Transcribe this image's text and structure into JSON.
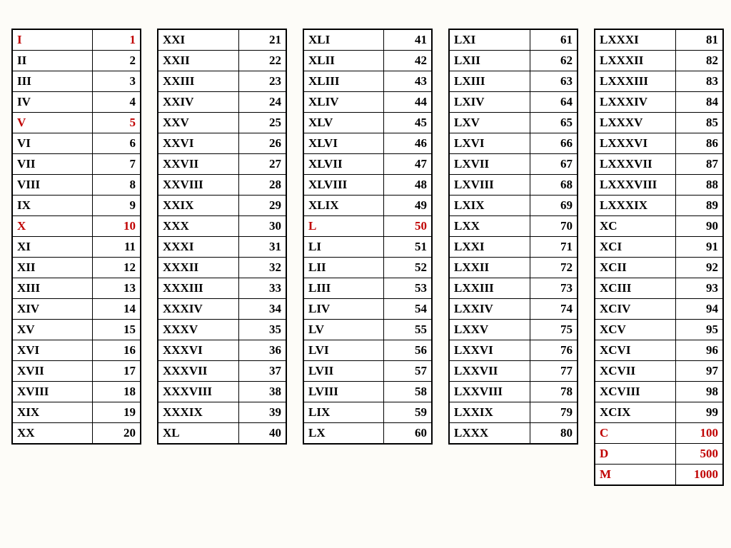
{
  "highlight_color": "#c00000",
  "columns": [
    [
      {
        "roman": "I",
        "arabic": 1,
        "highlight": true
      },
      {
        "roman": "II",
        "arabic": 2,
        "highlight": false
      },
      {
        "roman": "III",
        "arabic": 3,
        "highlight": false
      },
      {
        "roman": "IV",
        "arabic": 4,
        "highlight": false
      },
      {
        "roman": "V",
        "arabic": 5,
        "highlight": true
      },
      {
        "roman": "VI",
        "arabic": 6,
        "highlight": false
      },
      {
        "roman": "VII",
        "arabic": 7,
        "highlight": false
      },
      {
        "roman": "VIII",
        "arabic": 8,
        "highlight": false
      },
      {
        "roman": "IX",
        "arabic": 9,
        "highlight": false
      },
      {
        "roman": "X",
        "arabic": 10,
        "highlight": true
      },
      {
        "roman": "XI",
        "arabic": 11,
        "highlight": false
      },
      {
        "roman": "XII",
        "arabic": 12,
        "highlight": false
      },
      {
        "roman": "XIII",
        "arabic": 13,
        "highlight": false
      },
      {
        "roman": "XIV",
        "arabic": 14,
        "highlight": false
      },
      {
        "roman": "XV",
        "arabic": 15,
        "highlight": false
      },
      {
        "roman": "XVI",
        "arabic": 16,
        "highlight": false
      },
      {
        "roman": "XVII",
        "arabic": 17,
        "highlight": false
      },
      {
        "roman": "XVIII",
        "arabic": 18,
        "highlight": false
      },
      {
        "roman": "XIX",
        "arabic": 19,
        "highlight": false
      },
      {
        "roman": "XX",
        "arabic": 20,
        "highlight": false
      }
    ],
    [
      {
        "roman": "XXI",
        "arabic": 21,
        "highlight": false
      },
      {
        "roman": "XXII",
        "arabic": 22,
        "highlight": false
      },
      {
        "roman": "XXIII",
        "arabic": 23,
        "highlight": false
      },
      {
        "roman": "XXIV",
        "arabic": 24,
        "highlight": false
      },
      {
        "roman": "XXV",
        "arabic": 25,
        "highlight": false
      },
      {
        "roman": "XXVI",
        "arabic": 26,
        "highlight": false
      },
      {
        "roman": "XXVII",
        "arabic": 27,
        "highlight": false
      },
      {
        "roman": "XXVIII",
        "arabic": 28,
        "highlight": false
      },
      {
        "roman": "XXIX",
        "arabic": 29,
        "highlight": false
      },
      {
        "roman": "XXX",
        "arabic": 30,
        "highlight": false
      },
      {
        "roman": "XXXI",
        "arabic": 31,
        "highlight": false
      },
      {
        "roman": "XXXII",
        "arabic": 32,
        "highlight": false
      },
      {
        "roman": "XXXIII",
        "arabic": 33,
        "highlight": false
      },
      {
        "roman": "XXXIV",
        "arabic": 34,
        "highlight": false
      },
      {
        "roman": "XXXV",
        "arabic": 35,
        "highlight": false
      },
      {
        "roman": "XXXVI",
        "arabic": 36,
        "highlight": false
      },
      {
        "roman": "XXXVII",
        "arabic": 37,
        "highlight": false
      },
      {
        "roman": "XXXVIII",
        "arabic": 38,
        "highlight": false
      },
      {
        "roman": "XXXIX",
        "arabic": 39,
        "highlight": false
      },
      {
        "roman": "XL",
        "arabic": 40,
        "highlight": false
      }
    ],
    [
      {
        "roman": "XLI",
        "arabic": 41,
        "highlight": false
      },
      {
        "roman": "XLII",
        "arabic": 42,
        "highlight": false
      },
      {
        "roman": "XLIII",
        "arabic": 43,
        "highlight": false
      },
      {
        "roman": "XLIV",
        "arabic": 44,
        "highlight": false
      },
      {
        "roman": "XLV",
        "arabic": 45,
        "highlight": false
      },
      {
        "roman": "XLVI",
        "arabic": 46,
        "highlight": false
      },
      {
        "roman": "XLVII",
        "arabic": 47,
        "highlight": false
      },
      {
        "roman": "XLVIII",
        "arabic": 48,
        "highlight": false
      },
      {
        "roman": "XLIX",
        "arabic": 49,
        "highlight": false
      },
      {
        "roman": "L",
        "arabic": 50,
        "highlight": true
      },
      {
        "roman": "LI",
        "arabic": 51,
        "highlight": false
      },
      {
        "roman": "LII",
        "arabic": 52,
        "highlight": false
      },
      {
        "roman": "LIII",
        "arabic": 53,
        "highlight": false
      },
      {
        "roman": "LIV",
        "arabic": 54,
        "highlight": false
      },
      {
        "roman": "LV",
        "arabic": 55,
        "highlight": false
      },
      {
        "roman": "LVI",
        "arabic": 56,
        "highlight": false
      },
      {
        "roman": "LVII",
        "arabic": 57,
        "highlight": false
      },
      {
        "roman": "LVIII",
        "arabic": 58,
        "highlight": false
      },
      {
        "roman": "LIX",
        "arabic": 59,
        "highlight": false
      },
      {
        "roman": "LX",
        "arabic": 60,
        "highlight": false
      }
    ],
    [
      {
        "roman": "LXI",
        "arabic": 61,
        "highlight": false
      },
      {
        "roman": "LXII",
        "arabic": 62,
        "highlight": false
      },
      {
        "roman": "LXIII",
        "arabic": 63,
        "highlight": false
      },
      {
        "roman": "LXIV",
        "arabic": 64,
        "highlight": false
      },
      {
        "roman": "LXV",
        "arabic": 65,
        "highlight": false
      },
      {
        "roman": "LXVI",
        "arabic": 66,
        "highlight": false
      },
      {
        "roman": "LXVII",
        "arabic": 67,
        "highlight": false
      },
      {
        "roman": "LXVIII",
        "arabic": 68,
        "highlight": false
      },
      {
        "roman": "LXIX",
        "arabic": 69,
        "highlight": false
      },
      {
        "roman": "LXX",
        "arabic": 70,
        "highlight": false
      },
      {
        "roman": "LXXI",
        "arabic": 71,
        "highlight": false
      },
      {
        "roman": "LXXII",
        "arabic": 72,
        "highlight": false
      },
      {
        "roman": "LXXIII",
        "arabic": 73,
        "highlight": false
      },
      {
        "roman": "LXXIV",
        "arabic": 74,
        "highlight": false
      },
      {
        "roman": "LXXV",
        "arabic": 75,
        "highlight": false
      },
      {
        "roman": "LXXVI",
        "arabic": 76,
        "highlight": false
      },
      {
        "roman": "LXXVII",
        "arabic": 77,
        "highlight": false
      },
      {
        "roman": "LXXVIII",
        "arabic": 78,
        "highlight": false
      },
      {
        "roman": "LXXIX",
        "arabic": 79,
        "highlight": false
      },
      {
        "roman": "LXXX",
        "arabic": 80,
        "highlight": false
      }
    ],
    [
      {
        "roman": "LXXXI",
        "arabic": 81,
        "highlight": false
      },
      {
        "roman": "LXXXII",
        "arabic": 82,
        "highlight": false
      },
      {
        "roman": "LXXXIII",
        "arabic": 83,
        "highlight": false
      },
      {
        "roman": "LXXXIV",
        "arabic": 84,
        "highlight": false
      },
      {
        "roman": "LXXXV",
        "arabic": 85,
        "highlight": false
      },
      {
        "roman": "LXXXVI",
        "arabic": 86,
        "highlight": false
      },
      {
        "roman": "LXXXVII",
        "arabic": 87,
        "highlight": false
      },
      {
        "roman": "LXXXVIII",
        "arabic": 88,
        "highlight": false
      },
      {
        "roman": "LXXXIX",
        "arabic": 89,
        "highlight": false
      },
      {
        "roman": "XC",
        "arabic": 90,
        "highlight": false
      },
      {
        "roman": "XCI",
        "arabic": 91,
        "highlight": false
      },
      {
        "roman": "XCII",
        "arabic": 92,
        "highlight": false
      },
      {
        "roman": "XCIII",
        "arabic": 93,
        "highlight": false
      },
      {
        "roman": "XCIV",
        "arabic": 94,
        "highlight": false
      },
      {
        "roman": "XCV",
        "arabic": 95,
        "highlight": false
      },
      {
        "roman": "XCVI",
        "arabic": 96,
        "highlight": false
      },
      {
        "roman": "XCVII",
        "arabic": 97,
        "highlight": false
      },
      {
        "roman": "XCVIII",
        "arabic": 98,
        "highlight": false
      },
      {
        "roman": "XCIX",
        "arabic": 99,
        "highlight": false
      },
      {
        "roman": "C",
        "arabic": 100,
        "highlight": true
      },
      {
        "roman": "D",
        "arabic": 500,
        "highlight": true
      },
      {
        "roman": "M",
        "arabic": 1000,
        "highlight": true
      }
    ]
  ]
}
